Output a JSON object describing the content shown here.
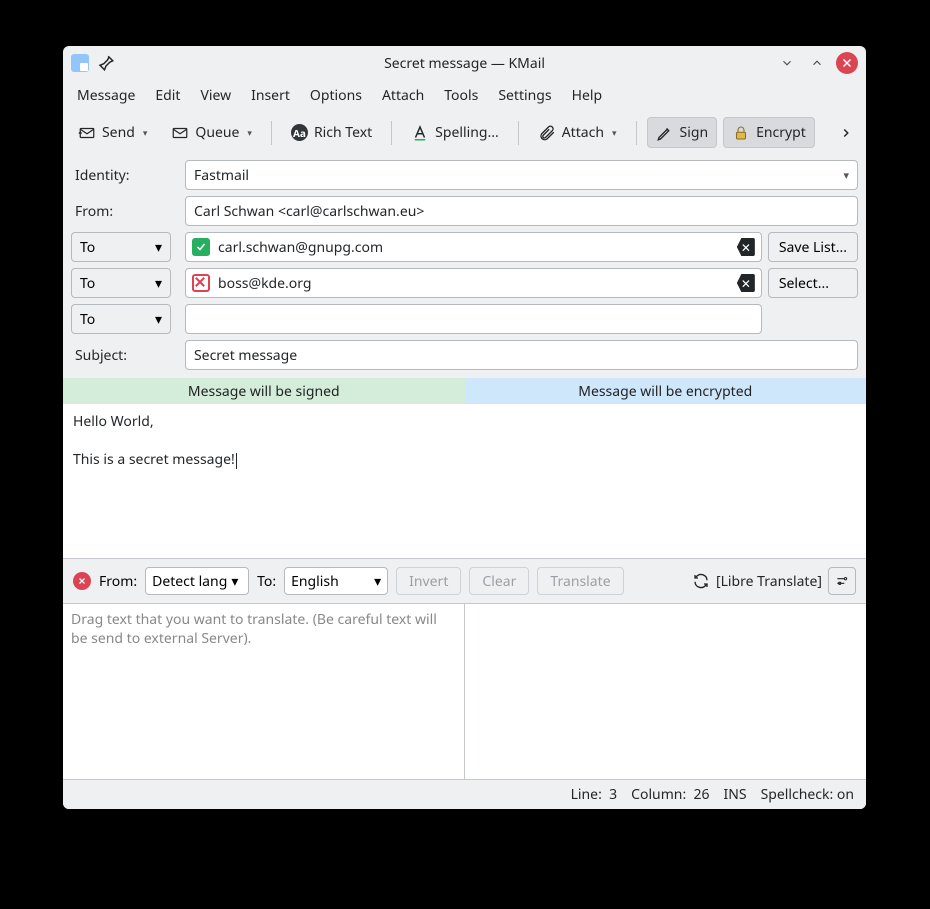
{
  "titlebar": {
    "title": "Secret message — KMail"
  },
  "menubar": [
    "Message",
    "Edit",
    "View",
    "Insert",
    "Options",
    "Attach",
    "Tools",
    "Settings",
    "Help"
  ],
  "toolbar": {
    "send": "Send",
    "queue": "Queue",
    "rich_text": "Rich Text",
    "spelling": "Spelling...",
    "attach": "Attach",
    "sign": "Sign",
    "encrypt": "Encrypt"
  },
  "headers": {
    "identity_label": "Identity:",
    "identity_value": "Fastmail",
    "from_label": "From:",
    "from_value": "Carl Schwan <carl@carlschwan.eu>",
    "type_to": "To",
    "recipients": [
      {
        "address": "carl.schwan@gnupg.com",
        "status": "ok"
      },
      {
        "address": "boss@kde.org",
        "status": "bad"
      }
    ],
    "save_list": "Save List...",
    "select": "Select...",
    "subject_label": "Subject:",
    "subject_value": "Secret message"
  },
  "strip": {
    "signed": "Message will be signed",
    "encrypted": "Message will be encrypted"
  },
  "body": "Hello World,\n\nThis is a secret message!",
  "translate": {
    "from_label": "From:",
    "from_lang": "Detect lang",
    "to_label": "To:",
    "to_lang": "English",
    "invert": "Invert",
    "clear": "Clear",
    "translate": "Translate",
    "engine": "[Libre Translate]",
    "placeholder": "Drag text that you want to translate. (Be careful text will be send to external Server)."
  },
  "status": {
    "line_label": "Line:",
    "line_value": "3",
    "column_label": "Column:",
    "column_value": "26",
    "ins": "INS",
    "spellcheck": "Spellcheck: on"
  }
}
